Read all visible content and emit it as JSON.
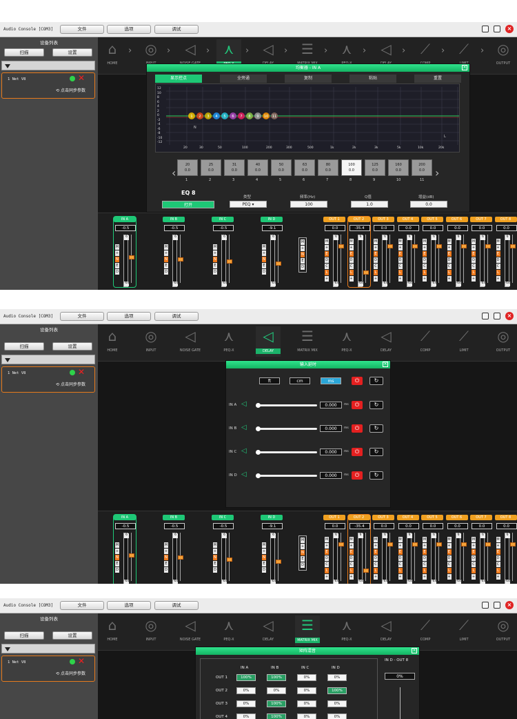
{
  "app": {
    "title": "Audio Console [COM3]",
    "menu": [
      "文件",
      "选项",
      "调试"
    ]
  },
  "sidebar": {
    "header": "设备列表",
    "scan": "扫描",
    "settings": "设置",
    "device_name": "1  Net V8",
    "sync": "点击同步参数"
  },
  "nav": [
    "HOME",
    "INPUT",
    "NOISE GATE",
    "PEQ-X",
    "DELAY",
    "MATRIX MIX",
    "PEQ-X",
    "DELAY",
    "COMP",
    "LIMIT",
    "OUTPUT"
  ],
  "peq": {
    "title": "均衡器 - IN A",
    "tabs": [
      "显示控点",
      "全旁通",
      "复制",
      "粘贴",
      "重置"
    ],
    "y_ticks": [
      "12",
      "10",
      "8",
      "6",
      "4",
      "2",
      "0",
      "-2",
      "-4",
      "-6",
      "-8",
      "-10",
      "-12"
    ],
    "x_ticks": [
      "20",
      "30",
      "50",
      "100",
      "200",
      "300",
      "500",
      "1k",
      "2k",
      "3k",
      "5k",
      "10k",
      "20k"
    ],
    "points": [
      "1",
      "2",
      "3",
      "4",
      "5",
      "6",
      "7",
      "8",
      "9",
      "10",
      "11"
    ],
    "marker_n": "N",
    "marker_l": "L",
    "bands": [
      {
        "f": "20",
        "g": "0.0",
        "n": "1"
      },
      {
        "f": "25",
        "g": "0.0",
        "n": "2"
      },
      {
        "f": "31",
        "g": "0.0",
        "n": "3"
      },
      {
        "f": "40",
        "g": "0.0",
        "n": "4"
      },
      {
        "f": "50",
        "g": "0.0",
        "n": "5"
      },
      {
        "f": "63",
        "g": "0.0",
        "n": "6"
      },
      {
        "f": "80",
        "g": "0.0",
        "n": "7"
      },
      {
        "f": "100",
        "g": "0.0",
        "n": "8"
      },
      {
        "f": "125",
        "g": "0.0",
        "n": "9"
      },
      {
        "f": "160",
        "g": "0.0",
        "n": "10"
      },
      {
        "f": "200",
        "g": "0.0",
        "n": "11"
      }
    ],
    "eq_name": "EQ 8",
    "open": "打开",
    "type_label": "类型",
    "type_value": "PEQ",
    "freq_label": "频率(Hz)",
    "freq_value": "100",
    "q_label": "Q值",
    "q_value": "1.0",
    "gain_label": "增益(dB)",
    "gain_value": "0.0"
  },
  "delay": {
    "title": "输入延时",
    "units": [
      "ft",
      "cm",
      "ms"
    ],
    "rows": [
      {
        "label": "IN A",
        "value": "0.000",
        "unit": "ms"
      },
      {
        "label": "IN B",
        "value": "0.000",
        "unit": "ms"
      },
      {
        "label": "IN C",
        "value": "0.000",
        "unit": "ms"
      },
      {
        "label": "IN D",
        "value": "0.000",
        "unit": "ms"
      }
    ]
  },
  "matrix": {
    "title": "矩阵混音",
    "cols": [
      "IN A",
      "IN B",
      "IN C",
      "IN D"
    ],
    "rows": [
      {
        "label": "OUT 1",
        "cells": [
          "100%",
          "100%",
          "0%",
          "0%"
        ]
      },
      {
        "label": "OUT 2",
        "cells": [
          "0%",
          "0%",
          "0%",
          "100%"
        ]
      },
      {
        "label": "OUT 3",
        "cells": [
          "0%",
          "100%",
          "0%",
          "0%"
        ]
      },
      {
        "label": "OUT 4",
        "cells": [
          "0%",
          "100%",
          "0%",
          "0%"
        ]
      }
    ],
    "side_title": "IN D - OUT 8",
    "side_value": "0%"
  },
  "strip": {
    "inputs": [
      {
        "name": "IN A",
        "value": "-0.5"
      },
      {
        "name": "IN B",
        "value": "-0.5"
      },
      {
        "name": "IN C",
        "value": "-0.5"
      },
      {
        "name": "IN D",
        "value": "-9.1"
      }
    ],
    "outputs": [
      {
        "name": "OUT 1",
        "value": "0.0"
      },
      {
        "name": "OUT 2",
        "value": "-35.4"
      },
      {
        "name": "OUT 3",
        "value": "0.0"
      },
      {
        "name": "OUT 4",
        "value": "0.0"
      },
      {
        "name": "OUT 5",
        "value": "0.0"
      },
      {
        "name": "OUT 6",
        "value": "0.0"
      },
      {
        "name": "OUT 7",
        "value": "0.0"
      },
      {
        "name": "OUT 8",
        "value": "0.0"
      }
    ],
    "meter_top": "6",
    "meter_bottom": "-64",
    "in_buttons": [
      "M",
      "+",
      "N",
      "E",
      "D"
    ],
    "out_buttons": [
      "M",
      "+",
      "E",
      "D",
      "C",
      "L",
      "+"
    ]
  },
  "colors": {
    "accent": "#1ec776",
    "orange": "#e87b1c",
    "red": "#e42020"
  }
}
